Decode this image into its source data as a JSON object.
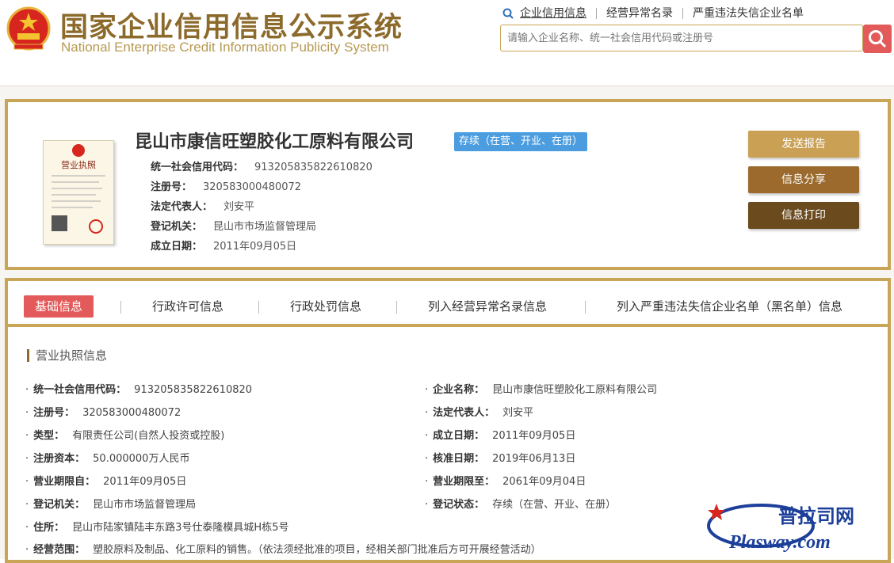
{
  "header": {
    "title_cn": "国家企业信用信息公示系统",
    "title_en": "National Enterprise Credit Information Publicity System",
    "nav": [
      "企业信用信息",
      "经营异常名录",
      "严重违法失信企业名单"
    ],
    "search_placeholder": "请输入企业名称、统一社会信用代码或注册号"
  },
  "company": {
    "name": "昆山市康信旺塑胶化工原料有限公司",
    "status": "存续（在营、开业、在册）",
    "credit_code_label": "统一社会信用代码：",
    "credit_code": "913205835822610820",
    "reg_no_label": "注册号：",
    "reg_no": "320583000480072",
    "legal_rep_label": "法定代表人：",
    "legal_rep": "刘安平",
    "authority_label": "登记机关：",
    "authority": "昆山市市场监督管理局",
    "founded_label": "成立日期：",
    "founded": "2011年09月05日",
    "cert_title": "营业执照"
  },
  "actions": {
    "send_report": "发送报告",
    "share": "信息分享",
    "print": "信息打印"
  },
  "tabs": [
    "基础信息",
    "行政许可信息",
    "行政处罚信息",
    "列入经营异常名录信息",
    "列入严重违法失信企业名单（黑名单）信息"
  ],
  "section": {
    "title": "营业执照信息",
    "rows": [
      {
        "label": "统一社会信用代码：",
        "value": "913205835822610820"
      },
      {
        "label": "企业名称：",
        "value": "昆山市康信旺塑胶化工原料有限公司"
      },
      {
        "label": "注册号：",
        "value": "320583000480072"
      },
      {
        "label": "法定代表人：",
        "value": "刘安平"
      },
      {
        "label": "类型：",
        "value": "有限责任公司(自然人投资或控股)"
      },
      {
        "label": "成立日期：",
        "value": "2011年09月05日"
      },
      {
        "label": "注册资本：",
        "value": "50.000000万人民币"
      },
      {
        "label": "核准日期：",
        "value": "2019年06月13日"
      },
      {
        "label": "营业期限自：",
        "value": "2011年09月05日"
      },
      {
        "label": "营业期限至：",
        "value": "2061年09月04日"
      },
      {
        "label": "登记机关：",
        "value": "昆山市市场监督管理局"
      },
      {
        "label": "登记状态：",
        "value": "存续（在营、开业、在册）"
      },
      {
        "label": "住所：",
        "value": "昆山市陆家镇陆丰东路3号仕泰隆模具城H栋5号"
      },
      {
        "label": "经营范围：",
        "value": "塑胶原料及制品、化工原料的销售。（依法须经批准的项目，经相关部门批准后方可开展经营活动）"
      }
    ]
  },
  "watermark": {
    "line1": "普拉司网",
    "line2": "Plasway.com"
  },
  "colors": {
    "gold": "#c9a657",
    "brown": "#8b6a2b",
    "red": "#e25a5a",
    "blue": "#4b9de0"
  }
}
